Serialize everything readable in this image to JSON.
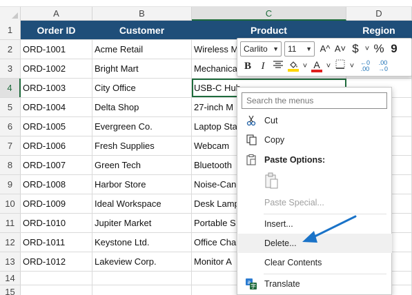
{
  "columns": [
    "A",
    "B",
    "C",
    "D"
  ],
  "header_row": {
    "num": "1",
    "cells": [
      "Order ID",
      "Customer",
      "Product",
      "Region"
    ]
  },
  "rows": [
    {
      "num": "2",
      "a": "ORD-1001",
      "b": "Acme Retail",
      "c": "Wireless M"
    },
    {
      "num": "3",
      "a": "ORD-1002",
      "b": "Bright Mart",
      "c": "Mechanica"
    },
    {
      "num": "4",
      "a": "ORD-1003",
      "b": "City Office",
      "c": "USB-C Hub"
    },
    {
      "num": "5",
      "a": "ORD-1004",
      "b": "Delta Shop",
      "c": "27-inch M"
    },
    {
      "num": "6",
      "a": "ORD-1005",
      "b": "Evergreen Co.",
      "c": "Laptop Sta"
    },
    {
      "num": "7",
      "a": "ORD-1006",
      "b": "Fresh Supplies",
      "c": "Webcam"
    },
    {
      "num": "8",
      "a": "ORD-1007",
      "b": "Green Tech",
      "c": "Bluetooth"
    },
    {
      "num": "9",
      "a": "ORD-1008",
      "b": "Harbor Store",
      "c": "Noise-Canc"
    },
    {
      "num": "10",
      "a": "ORD-1009",
      "b": "Ideal Workspace",
      "c": "Desk Lamp"
    },
    {
      "num": "11",
      "a": "ORD-1010",
      "b": "Jupiter Market",
      "c": "Portable S"
    },
    {
      "num": "12",
      "a": "ORD-1011",
      "b": "Keystone Ltd.",
      "c": "Office Cha"
    },
    {
      "num": "13",
      "a": "ORD-1012",
      "b": "Lakeview Corp.",
      "c": "Monitor A"
    }
  ],
  "empty_rows": [
    "14",
    "15"
  ],
  "mini_toolbar": {
    "font_name": "Carlito",
    "font_size": "11",
    "grow_font": "A^",
    "shrink_font": "A˅",
    "currency": "$",
    "percent": "%",
    "comma": "9",
    "bold": "B",
    "italic": "I",
    "font_color_letter": "A",
    "inc_decimal": "←0\n.00",
    "dec_decimal": ".00\n→0"
  },
  "context_menu": {
    "search_placeholder": "Search the menus",
    "cut": "Cut",
    "copy": "Copy",
    "paste_options": "Paste Options:",
    "paste_special": "Paste Special...",
    "insert": "Insert...",
    "delete": "Delete...",
    "clear_contents": "Clear Contents",
    "translate": "Translate"
  },
  "colors": {
    "header_bg": "#1f4e79",
    "selection": "#1e6b3c",
    "arrow": "#1a73c8"
  }
}
